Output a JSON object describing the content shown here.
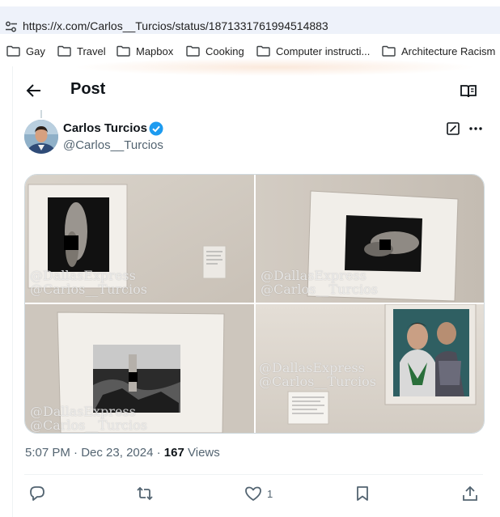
{
  "browser": {
    "url": "https://x.com/Carlos__Turcios/status/1871331761994514883",
    "site_icon": "tune-icon"
  },
  "bookmarks": [
    {
      "label": "Gay",
      "icon": "folder-icon"
    },
    {
      "label": "Travel",
      "icon": "folder-icon"
    },
    {
      "label": "Mapbox",
      "icon": "folder-icon"
    },
    {
      "label": "Cooking",
      "icon": "folder-icon"
    },
    {
      "label": "Computer instructi...",
      "icon": "folder-icon"
    },
    {
      "label": "Architecture Racism",
      "icon": "folder-icon"
    }
  ],
  "header": {
    "title": "Post",
    "back_icon": "arrow-left-icon",
    "reader_icon": "book-open-icon"
  },
  "author": {
    "name": "Carlos Turcios",
    "handle": "@Carlos__Turcios",
    "verified": true,
    "badge_color": "#1d9bf0"
  },
  "media": {
    "watermark_line1": "@DallasExpress",
    "watermark_line2": "@Carlos__Turcios"
  },
  "meta": {
    "time": "5:07 PM",
    "separator": "·",
    "date": "Dec 23, 2024",
    "views_count": "167",
    "views_label": "Views"
  },
  "actions": {
    "reply_icon": "reply-icon",
    "repost_icon": "repost-icon",
    "like_icon": "heart-icon",
    "like_count": "1",
    "bookmark_icon": "bookmark-icon",
    "share_icon": "share-icon"
  },
  "colors": {
    "text": "#0f1419",
    "secondary": "#536471",
    "accent": "#1d9bf0",
    "border": "#eff3f4"
  }
}
